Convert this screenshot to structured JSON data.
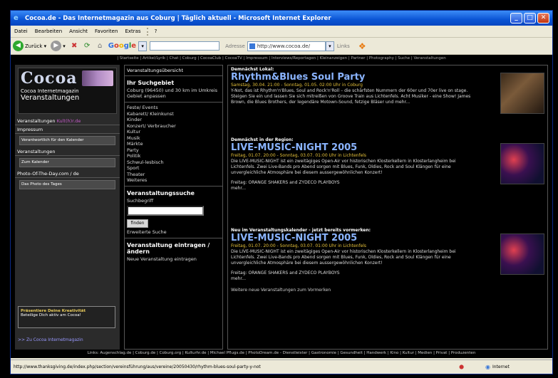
{
  "window": {
    "title": "Cocoa.de - Das Internetmagazin aus Coburg | Täglich aktuell - Microsoft Internet Explorer",
    "minimize": "_",
    "maximize": "□",
    "close": "✕"
  },
  "menu": [
    "Datei",
    "Bearbeiten",
    "Ansicht",
    "Favoriten",
    "Extras",
    "?"
  ],
  "toolbar": {
    "back_label": "Zurück",
    "google_search_placeholder": "",
    "address_label": "Adresse",
    "address_value": "http://www.cocoa.de/",
    "links_label": "Links"
  },
  "top_nav": "| Startseite | Artikel/Lyrik | Chat | Coburg | CocoaClub | CocoaTV | Impressum | Interviews/Reportagen | Kleinanzeigen | Partner | Photography | Suche | Veranstaltungen",
  "left": {
    "logo": "Cocoa",
    "logo_sub1": "Cocoa Internetmagazin",
    "logo_sub2": "Veranstaltungen",
    "nav_kult_prefix": "Veranstaltungen",
    "nav_kult": "Kult(h)r.de",
    "nav_impressum": "Impressum",
    "btn_kalender": "Verantwortlich für den Kalender",
    "nav_veranstaltungen": "Veranstaltungen",
    "btn_zum_kalender": "Zum Kalender",
    "nav_photo": "Photo-Of-The-Day.com / de",
    "btn_photo": "Das Photo des Tages",
    "box_title": "Präsentiere Deine Kreativität",
    "box_text": "Beteilige Dich aktiv am Cocoa!",
    "footer_link": ">> Zu Cocoa Internetmagazin"
  },
  "mid": {
    "header": "Veranstaltungsübersicht",
    "search_area_title": "Ihr Suchgebiet",
    "search_area_text": "Coburg (96450) und 30 km im Umkreis",
    "search_area_link": "Gebiet anpassen",
    "categories": [
      "Feste/ Events",
      "Kabarett/ Kleinkunst",
      "Kinder",
      "Konzert/ Verbraucher",
      "Kultur",
      "Musik",
      "Märkte",
      "Party",
      "Politik",
      "Schwul-lesbisch",
      "Sport",
      "Theater",
      "Weiteres"
    ],
    "search_title": "Veranstaltungssuche",
    "search_label": "Suchbegriff",
    "search_button": "finden",
    "search_advanced": "Erweiterte Suche",
    "add_title": "Veranstaltung eintragen / ändern",
    "add_link": "Neue Veranstaltung eintragen"
  },
  "events": [
    {
      "pre": "Demnächst Lokal:",
      "title": "Rhythm&Blues Soul Party",
      "date": "Samstag, 30.04. 21:00 - Sonntag, 01.05. 02:00 Uhr in Coburg",
      "desc": "Y-Not, das ist Rhythm'n'Blues, Soul and Rock'n'Roll – die schärfsten Nummern der 60er und 70er live on stage. Steigen Sie ein und lassen Sie sich mitreißen von Groove Train aus Lichtenfels. Acht Musiker - eine Show! James Brown, die Blues Brothers, der legendäre Motown-Sound, fetzige Bläser und mehr...",
      "extra": "",
      "more": ""
    },
    {
      "pre": "Demnächst in der Region:",
      "title": "LIVE-MUSIC-NIGHT 2005",
      "date": "Freitag, 01.07. 20:00 - Sonntag, 03.07. 01:00 Uhr in Lichtenfels",
      "desc": "Die LIVE-MUSIC-NIGHT ist ein zweitägiges Open-Air vor historischen Klosterkellern in Klosterlangheim bei Lichtenfels. Zwei Live-Bands pro Abend sorgen mit Blues, Funk, Oldies, Rock and Soul Klängen für eine unvergleichliche Atmosphäre bei diesem aussergewöhnlichen Konzert!",
      "extra": "Freitag: ORANGE SHAKERS and ZYDECO PLAYBOYS",
      "more": "mehr..."
    },
    {
      "pre": "Neu im Veranstaltungskalender - jetzt bereits vormerken:",
      "title": "LIVE-MUSIC-NIGHT 2005",
      "date": "Freitag, 01.07. 20:00 - Sonntag, 03.07. 01:00 Uhr in Lichtenfels",
      "desc": "Die LIVE-MUSIC-NIGHT ist ein zweitägiges Open-Air vor historischen Klosterkellern in Klosterlangheim bei Lichtenfels. Zwei Live-Bands pro Abend sorgen mit Blues, Funk, Oldies, Rock and Soul Klängen für eine unvergleichliche Atmosphäre bei diesem aussergewöhnlichen Konzert!",
      "extra": "Freitag: ORANGE SHAKERS and ZYDECO PLAYBOYS",
      "more": "mehr..."
    }
  ],
  "more_events": "Weitere neue Veranstaltungen zum Vormerken",
  "footer_links": "Links: Augenschlag.de | Coburg.de | Coburg.org | Kulturhr.de | Michael Pflugs.de | PhotoDream.de - Dienstleister | Gastronomie | Gesundheit | Handwerk | Kino | Kultur | Medien | Privat | Produzenten",
  "status": {
    "url": "http://www.thanksgiving.de/index.php/section/vereinsführung/aus/vereine/20050430/rhythm-blues-soul-party-y-not",
    "zone": "Internet"
  }
}
